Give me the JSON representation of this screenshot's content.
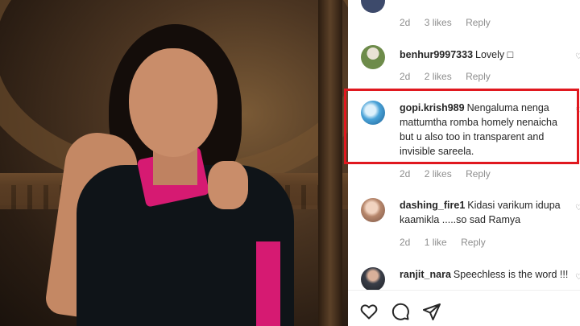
{
  "comments": [
    {
      "username": "",
      "text": "",
      "time": "2d",
      "likes": "3 likes",
      "reply": "Reply"
    },
    {
      "username": "benhur9997333",
      "text": "Lovely □",
      "time": "2d",
      "likes": "2 likes",
      "reply": "Reply"
    },
    {
      "username": "gopi.krish989",
      "text": "Nengaluma nenga mattumtha romba homely nenaicha but u also too in transparent and invisible sareela.",
      "time": "2d",
      "likes": "2 likes",
      "reply": "Reply"
    },
    {
      "username": "dashing_fire1",
      "text": "Kidasi varikum idupa kaamikla .....so sad Ramya",
      "time": "2d",
      "likes": "1 like",
      "reply": "Reply"
    },
    {
      "username": "ranjit_nara",
      "text": "Speechless is the word !!!",
      "time": "",
      "likes": "",
      "reply": ""
    }
  ],
  "actions": {
    "like_icon": "heart-icon",
    "comment_icon": "comment-icon",
    "share_icon": "share-icon"
  },
  "colors": {
    "highlight": "#e0181f",
    "meta_text": "#8e8e8e",
    "body_text": "#262626"
  }
}
